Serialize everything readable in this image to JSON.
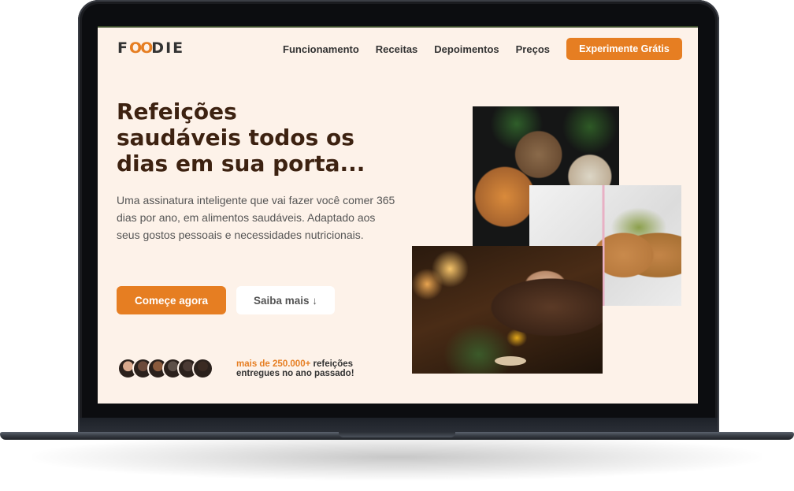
{
  "app": {
    "logo": {
      "pre": "F",
      "oo": "OO",
      "post": "DIE"
    }
  },
  "nav": {
    "items": [
      {
        "label": "Funcionamento"
      },
      {
        "label": "Receitas"
      },
      {
        "label": "Depoimentos"
      },
      {
        "label": "Preços"
      }
    ],
    "cta": "Experimente Grátis"
  },
  "hero": {
    "title": "Refeições saudáveis todos os dias em sua porta...",
    "description": "Uma assinatura inteligente que vai fazer você comer 365 dias por ano, em alimentos saudáveis. Adaptado aos seus gostos pessoais e necessidades nutricionais.",
    "primary_button": "Começe agora",
    "secondary_button": "Saiba mais ↓"
  },
  "social_proof": {
    "highlight": "mais de 250.000+",
    "text": " refeições entregues no ano passado!",
    "avatars": [
      {
        "color": "#d9a98d"
      },
      {
        "color": "#6c4a3a"
      },
      {
        "color": "#8a5a3c"
      },
      {
        "color": "#5d5048"
      },
      {
        "color": "#4a3a34"
      },
      {
        "color": "#3a2a22"
      }
    ]
  },
  "colors": {
    "accent": "#e67e22",
    "background": "#fdf2e9",
    "heading": "#3d2211"
  }
}
